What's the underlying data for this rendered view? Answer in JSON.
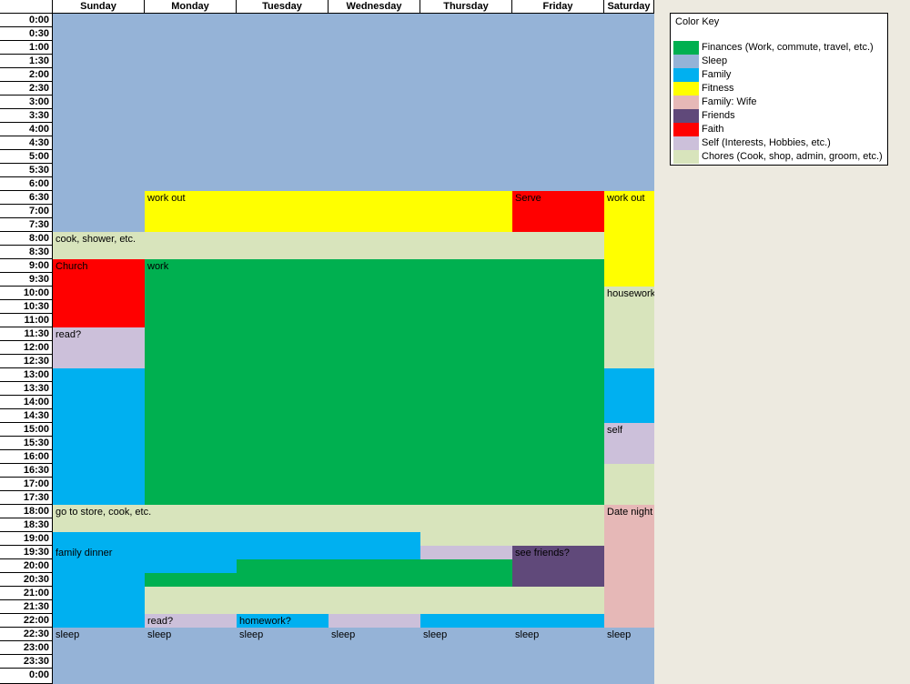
{
  "days": [
    "Sunday",
    "Monday",
    "Tuesday",
    "Wednesday",
    "Thursday",
    "Friday",
    "Saturday"
  ],
  "times": [
    "0:00",
    "0:30",
    "1:00",
    "1:30",
    "2:00",
    "2:30",
    "3:00",
    "3:30",
    "4:00",
    "4:30",
    "5:00",
    "5:30",
    "6:00",
    "6:30",
    "7:00",
    "7:30",
    "8:00",
    "8:30",
    "9:00",
    "9:30",
    "10:00",
    "10:30",
    "11:00",
    "11:30",
    "12:00",
    "12:30",
    "13:00",
    "13:30",
    "14:00",
    "14:30",
    "15:00",
    "15:30",
    "16:00",
    "16:30",
    "17:00",
    "17:30",
    "18:00",
    "18:30",
    "19:00",
    "19:30",
    "20:00",
    "20:30",
    "21:00",
    "21:30",
    "22:00",
    "22:30",
    "23:00",
    "23:30",
    "0:00"
  ],
  "colors": {
    "finances": "#00b050",
    "sleep": "#95b3d7",
    "family": "#00b0f0",
    "fitness": "#ffff00",
    "wife": "#e6b8b7",
    "friends": "#60497a",
    "faith": "#ff0000",
    "self": "#ccc0da",
    "chores": "#d8e4bc"
  },
  "blocks": [
    {
      "cat": "sleep",
      "d0": 0,
      "d1": 7,
      "s": 0,
      "e": 13,
      "label": ""
    },
    {
      "cat": "sleep",
      "d0": 0,
      "d1": 1,
      "s": 13,
      "e": 16,
      "label": ""
    },
    {
      "cat": "fitness",
      "d0": 1,
      "d1": 5,
      "s": 13,
      "e": 16,
      "label": "work out"
    },
    {
      "cat": "faith",
      "d0": 5,
      "d1": 6,
      "s": 13,
      "e": 16,
      "label": "Serve"
    },
    {
      "cat": "fitness",
      "d0": 6,
      "d1": 7,
      "s": 13,
      "e": 20,
      "label": "work out"
    },
    {
      "cat": "chores",
      "d0": 0,
      "d1": 6,
      "s": 16,
      "e": 18,
      "label": "cook, shower, etc."
    },
    {
      "cat": "faith",
      "d0": 0,
      "d1": 1,
      "s": 18,
      "e": 23,
      "label": "Church"
    },
    {
      "cat": "finances",
      "d0": 1,
      "d1": 6,
      "s": 18,
      "e": 36,
      "label": "work"
    },
    {
      "cat": "chores",
      "d0": 6,
      "d1": 7,
      "s": 20,
      "e": 26,
      "label": "housework, etc."
    },
    {
      "cat": "self",
      "d0": 0,
      "d1": 1,
      "s": 23,
      "e": 26,
      "label": "read?"
    },
    {
      "cat": "family",
      "d0": 0,
      "d1": 1,
      "s": 26,
      "e": 36,
      "label": ""
    },
    {
      "cat": "family",
      "d0": 6,
      "d1": 7,
      "s": 26,
      "e": 30,
      "label": ""
    },
    {
      "cat": "self",
      "d0": 6,
      "d1": 7,
      "s": 30,
      "e": 33,
      "label": "self"
    },
    {
      "cat": "chores",
      "d0": 6,
      "d1": 7,
      "s": 33,
      "e": 36,
      "label": ""
    },
    {
      "cat": "chores",
      "d0": 0,
      "d1": 6,
      "s": 36,
      "e": 38,
      "label": "go to store, cook, etc."
    },
    {
      "cat": "wife",
      "d0": 6,
      "d1": 7,
      "s": 36,
      "e": 45,
      "label": "Date night"
    },
    {
      "cat": "family",
      "d0": 0,
      "d1": 1,
      "s": 38,
      "e": 45,
      "label": ""
    },
    {
      "cat": "family",
      "d0": 1,
      "d1": 4,
      "s": 38,
      "e": 39,
      "label": ""
    },
    {
      "cat": "chores",
      "d0": 4,
      "d1": 6,
      "s": 38,
      "e": 39,
      "label": ""
    },
    {
      "cat": "family",
      "d0": 0,
      "d1": 4,
      "s": 39,
      "e": 40,
      "label": "family dinner"
    },
    {
      "cat": "self",
      "d0": 4,
      "d1": 5,
      "s": 39,
      "e": 40,
      "label": ""
    },
    {
      "cat": "friends",
      "d0": 5,
      "d1": 6,
      "s": 39,
      "e": 42,
      "label": "see friends?"
    },
    {
      "cat": "family",
      "d0": 1,
      "d1": 2,
      "s": 40,
      "e": 41,
      "label": ""
    },
    {
      "cat": "finances",
      "d0": 2,
      "d1": 5,
      "s": 40,
      "e": 42,
      "label": ""
    },
    {
      "cat": "finances",
      "d0": 1,
      "d1": 2,
      "s": 41,
      "e": 42,
      "label": ""
    },
    {
      "cat": "chores",
      "d0": 1,
      "d1": 6,
      "s": 42,
      "e": 44,
      "label": ""
    },
    {
      "cat": "self",
      "d0": 1,
      "d1": 2,
      "s": 44,
      "e": 45,
      "label": "read?"
    },
    {
      "cat": "family",
      "d0": 2,
      "d1": 3,
      "s": 44,
      "e": 45,
      "label": "homework?"
    },
    {
      "cat": "self",
      "d0": 3,
      "d1": 4,
      "s": 44,
      "e": 45,
      "label": ""
    },
    {
      "cat": "family",
      "d0": 4,
      "d1": 6,
      "s": 44,
      "e": 45,
      "label": ""
    },
    {
      "cat": "sleep",
      "d0": 0,
      "d1": 1,
      "s": 45,
      "e": 49,
      "label": "sleep"
    },
    {
      "cat": "sleep",
      "d0": 1,
      "d1": 2,
      "s": 45,
      "e": 49,
      "label": "sleep"
    },
    {
      "cat": "sleep",
      "d0": 2,
      "d1": 3,
      "s": 45,
      "e": 49,
      "label": "sleep"
    },
    {
      "cat": "sleep",
      "d0": 3,
      "d1": 4,
      "s": 45,
      "e": 49,
      "label": "sleep"
    },
    {
      "cat": "sleep",
      "d0": 4,
      "d1": 5,
      "s": 45,
      "e": 49,
      "label": "sleep"
    },
    {
      "cat": "sleep",
      "d0": 5,
      "d1": 6,
      "s": 45,
      "e": 49,
      "label": "sleep"
    },
    {
      "cat": "sleep",
      "d0": 6,
      "d1": 7,
      "s": 45,
      "e": 49,
      "label": "sleep"
    }
  ],
  "key": {
    "title": "Color Key",
    "items": [
      {
        "cat": "finances",
        "label": "Finances  (Work, commute, travel, etc.)"
      },
      {
        "cat": "sleep",
        "label": "Sleep"
      },
      {
        "cat": "family",
        "label": "Family"
      },
      {
        "cat": "fitness",
        "label": "Fitness"
      },
      {
        "cat": "wife",
        "label": "Family: Wife"
      },
      {
        "cat": "friends",
        "label": "Friends"
      },
      {
        "cat": "faith",
        "label": "Faith"
      },
      {
        "cat": "self",
        "label": "Self (Interests, Hobbies, etc.)"
      },
      {
        "cat": "chores",
        "label": "Chores (Cook, shop, admin, groom, etc.)"
      }
    ]
  }
}
